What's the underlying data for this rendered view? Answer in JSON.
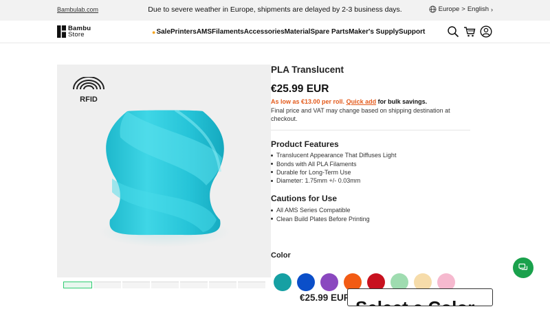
{
  "topbar": {
    "site_link": "Bambulab.com",
    "notice": "Due to severe weather in Europe, shipments are delayed by 2-3 business days.",
    "region": "Europe",
    "language": "English",
    "separator": ">",
    "icon": "globe-icon"
  },
  "header": {
    "logo_line1": "Bambu",
    "logo_line2": "Store",
    "nav": [
      {
        "label": "Sale",
        "icon": "flame-icon"
      },
      {
        "label": "Printers"
      },
      {
        "label": "AMS"
      },
      {
        "label": "Filaments"
      },
      {
        "label": "Accessories"
      },
      {
        "label": "Material"
      },
      {
        "label": "Spare Parts"
      },
      {
        "label": "Maker's Supply"
      },
      {
        "label": "Support"
      }
    ],
    "icons": [
      "search-icon",
      "cart-icon",
      "account-icon"
    ]
  },
  "gallery": {
    "badge": "RFID",
    "thumbnail_count": 7,
    "spool_color": "#2ec6d6"
  },
  "product": {
    "title": "PLA Translucent",
    "price": "€25.99 EUR",
    "bulk_low": "As low as €13.00 per roll.",
    "bulk_quick": "Quick add",
    "bulk_rest": "for bulk savings.",
    "final_note": "Final price and VAT may change based on shipping destination at checkout.",
    "features_heading": "Product Features",
    "features": [
      "Translucent Appearance That Diffuses Light",
      "Bonds with All PLA Filaments",
      "Durable for Long-Term Use",
      "Diameter: 1.75mm +/- 0.03mm"
    ],
    "cautions_heading": "Cautions for Use",
    "cautions": [
      "All AMS Series Compatible",
      "Clean Build Plates Before Printing"
    ],
    "color_label": "Color",
    "swatches": [
      "#16a0a3",
      "#0b4fc9",
      "#8a48bf",
      "#f25b14",
      "#c8111f",
      "#9fdcb0",
      "#f6dcaa",
      "#f6b9cf"
    ]
  },
  "sticky": {
    "price": "€25.99 EUR",
    "button": "Select a Color"
  },
  "chat": {
    "icon": "chat-icon",
    "color": "#1aa14c"
  }
}
